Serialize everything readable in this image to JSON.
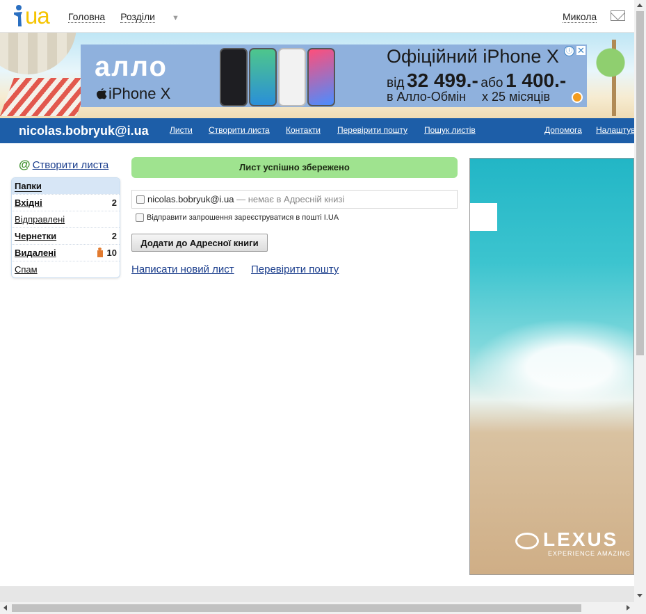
{
  "header": {
    "logo_text": "ua",
    "nav": [
      {
        "label": "Головна"
      },
      {
        "label": "Розділи"
      }
    ],
    "dropdown_glyph": "▼",
    "user": "Микола",
    "mail_icon": "envelope-icon"
  },
  "banner_ad": {
    "brand": "алло",
    "model": "iPhone X",
    "title": "Офіційний iPhone X",
    "from_label": "від",
    "price": "32 499.-",
    "or_label": "або",
    "monthly": "1 400.-",
    "tradein_label": "в Алло-Обмін",
    "months_label": "х 25 місяців",
    "info_glyph": "ⓘ",
    "close_glyph": "✕"
  },
  "mailbar": {
    "account": "nicolas.bobryuk@i.ua",
    "links": [
      {
        "label": "Листи"
      },
      {
        "label": "Створити листа"
      },
      {
        "label": "Контакти"
      },
      {
        "label": "Перевірити пошту"
      },
      {
        "label": "Пошук листів"
      },
      {
        "label": "Допомога"
      },
      {
        "label": "Налаштування"
      }
    ]
  },
  "sidebar": {
    "at_glyph": "@",
    "create_label": "Створити листа",
    "folders_title": "Папки",
    "folders": [
      {
        "label": "Вхідні",
        "count": "2"
      },
      {
        "label": "Відправлені",
        "count": ""
      },
      {
        "label": "Чернетки",
        "count": "2"
      },
      {
        "label": "Видалені",
        "count": "10"
      },
      {
        "label": "Спам",
        "count": ""
      }
    ]
  },
  "main": {
    "success_message": "Лист успішно збережено",
    "contact_email": "nicolas.bobryuk@i.ua",
    "contact_note": " — немає в Адресній книзі",
    "invite_label": "Відправити запрошення зареєструватися в пошті I.UA",
    "add_button": "Додати до Адресної книги",
    "links": [
      {
        "label": "Написати новий лист"
      },
      {
        "label": "Перевірити пошту"
      }
    ]
  },
  "side_ad": {
    "brand": "LEXUS",
    "slogan": "EXPERIENCE AMAZING"
  }
}
